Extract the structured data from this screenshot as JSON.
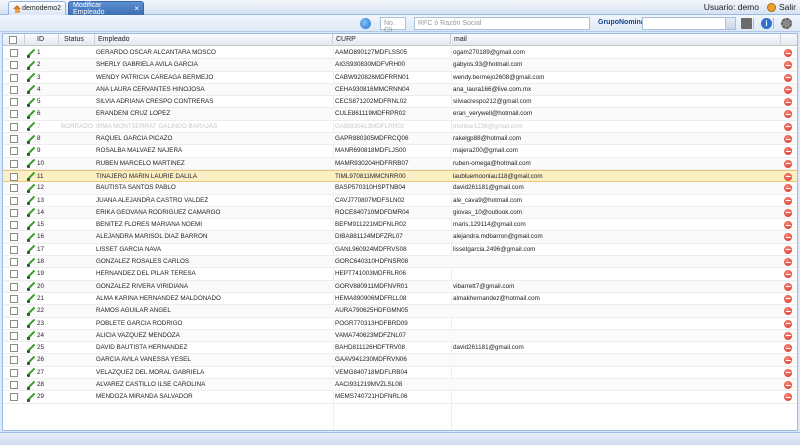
{
  "tabs": [
    {
      "label": "demodemo2"
    },
    {
      "label": "Modificar Empleado"
    }
  ],
  "user": {
    "label": "Usuario:",
    "name": "demo",
    "logout": "Salir"
  },
  "toolbar": {
    "cli_placeholder": "No. Cli",
    "rfc_placeholder": "RFC ó Razón Social",
    "gruponomina_label": "GrupoNomina :",
    "gruponomina_value": ""
  },
  "grid": {
    "headers": {
      "id": "ID",
      "status": "Status",
      "empleado": "Empleado",
      "curp": "CURP",
      "mail": "mail"
    },
    "rows": [
      {
        "id": "1",
        "status": "",
        "empleado": "GERARDO OSCAR ALCANTARA MOSCO",
        "curp": "AAMO890127MDFLSS05",
        "mail": "ogam270189@gmail.com"
      },
      {
        "id": "2",
        "status": "",
        "empleado": "SHERLY GABRIELA AVILA GARCIA",
        "curp": "AIGS930830MDFVRH00",
        "mail": "gabyos.93@hotmail.com"
      },
      {
        "id": "3",
        "status": "",
        "empleado": "WENDY PATRICIA CAREAGA BERMEJO",
        "curp": "CABW920826MDFRRN01",
        "mail": "wendy.bermejo2608@gmail.com"
      },
      {
        "id": "4",
        "status": "",
        "empleado": "ANA LAURA CERVANTES HINOJOSA",
        "curp": "CEHA930816MMCRNN04",
        "mail": "ana_laura166@live.com.mx"
      },
      {
        "id": "5",
        "status": "",
        "empleado": "SILVIA ADRIANA CRESPO CONTRERAS",
        "curp": "CECS871202MDFRNL02",
        "mail": "silviacrespo212@gmail.com"
      },
      {
        "id": "6",
        "status": "",
        "empleado": "ERANDENI CRUZ LOPEZ",
        "curp": "CULE861119MDFRPR02",
        "mail": "eran_verywell@hotmail.com"
      },
      {
        "id": "7",
        "status": "BORRADO",
        "empleado": "IRMA MONTSERRAT GALINDO BARAJAS",
        "curp": "GABI930413MDFLRR02",
        "mail": "montse1236@gmail.com",
        "disabled": true
      },
      {
        "id": "8",
        "status": "",
        "empleado": "RAQUEL GARCIA PICAZO",
        "curp": "GAPR880305MDFRCQ06",
        "mail": "rakelgp88@hotmail.com"
      },
      {
        "id": "9",
        "status": "",
        "empleado": "ROSALBA MALVAEZ NAJERA",
        "curp": "MANR690818MDFLJS00",
        "mail": "majera200@gmail.com"
      },
      {
        "id": "10",
        "status": "",
        "empleado": "RUBEN MARCELO MARTINEZ",
        "curp": "MAMR930204HDFRRB07",
        "mail": "ruben-omega@hotmail.com"
      },
      {
        "id": "11",
        "status": "",
        "empleado": "TINAJERO MARIN LAURIE DALILA",
        "curp": "TIML970811MMCNRR00",
        "mail": "laubluemoonlau118@gmail.com",
        "selected": true
      },
      {
        "id": "12",
        "status": "",
        "empleado": "BAUTISTA SANTOS PABLO",
        "curp": "BASP570310HSPTNB04",
        "mail": "david261181@gmail.com"
      },
      {
        "id": "13",
        "status": "",
        "empleado": "JUANA ALEJANDRA CASTRO VALDEZ",
        "curp": "CAVJ770807MDFSLN02",
        "mail": "ale_cava9@hotmail.com"
      },
      {
        "id": "14",
        "status": "",
        "empleado": "ERIKA GEOVANA RODRIGUEZ CAMARGO",
        "curp": "ROCE840710MDFDMR04",
        "mail": "giovas_10@outlook.com"
      },
      {
        "id": "15",
        "status": "",
        "empleado": "BENITEZ FLORES MARIANA NOEMI",
        "curp": "BEFM911221MDFNLR02",
        "mail": "maris.129114@gmail.com"
      },
      {
        "id": "16",
        "status": "",
        "empleado": "ALEJANDRA MARISOL DIAZ BARRON",
        "curp": "DIBA881124MDFZRL07",
        "mail": "alejandra.mdbarron@gmail.com"
      },
      {
        "id": "17",
        "status": "",
        "empleado": "LISSET GARCIA NAVA",
        "curp": "GANL960924MDFRVS08",
        "mail": "lissetgarcia.2496@gmail.com"
      },
      {
        "id": "18",
        "status": "",
        "empleado": "GONZALEZ ROSALES CARLOS",
        "curp": "GORC640310HDFNSR08",
        "mail": ""
      },
      {
        "id": "19",
        "status": "",
        "empleado": "HERNANDEZ DEL PILAR TERESA",
        "curp": "HEPT741003MDFRLR06",
        "mail": ""
      },
      {
        "id": "20",
        "status": "",
        "empleado": "GONZALEZ RIVERA VIRIDIANA",
        "curp": "GORV880911MDFNVR01",
        "mail": "vibarrett7@gmail.com"
      },
      {
        "id": "21",
        "status": "",
        "empleado": "ALMA KARINA HERNANDEZ MALDONADO",
        "curp": "HEMA890906MDFRLL08",
        "mail": "almakhernandez@hotmail.com"
      },
      {
        "id": "22",
        "status": "",
        "empleado": "RAMOS AGUILAR ANGEL",
        "curp": "AURA790625HDFGMN05",
        "mail": ""
      },
      {
        "id": "23",
        "status": "",
        "empleado": "POBLETE GARCIA RODRIGO",
        "curp": "POGR770313HDFBRD09",
        "mail": ""
      },
      {
        "id": "24",
        "status": "",
        "empleado": "ALICIA VAZQUEZ MENDOZA",
        "curp": "VAMA740623MDFZNL07",
        "mail": ""
      },
      {
        "id": "25",
        "status": "",
        "empleado": "DAVID BAUTISTA HERNANDEZ",
        "curp": "BAHD811126HDFTRV08",
        "mail": "david261181@gmail.com"
      },
      {
        "id": "26",
        "status": "",
        "empleado": "GARCIA AVILA VANESSA YESEL",
        "curp": "GAAV941230MDFRVN06",
        "mail": ""
      },
      {
        "id": "27",
        "status": "",
        "empleado": "VELAZQUEZ DEL MORAL GABRIELA",
        "curp": "VEMG840718MDFLRB04",
        "mail": ""
      },
      {
        "id": "28",
        "status": "",
        "empleado": "ALVAREZ CASTILLO ILSE CAROLINA",
        "curp": "AACI931219MVZLSL08",
        "mail": ""
      },
      {
        "id": "29",
        "status": "",
        "empleado": "MENDOZA MIRANDA SALVADOR",
        "curp": "MEMS740721HDFNRL06",
        "mail": ""
      }
    ]
  }
}
